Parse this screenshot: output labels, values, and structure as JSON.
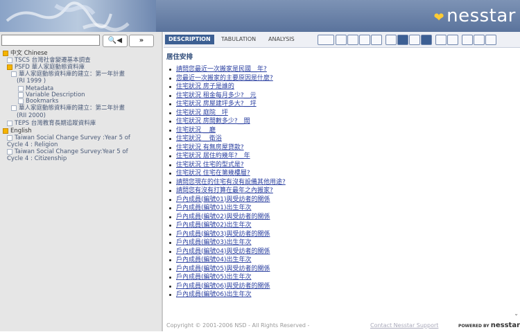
{
  "header": {
    "logo_text": "nesstar",
    "logo_mark": "❤"
  },
  "search": {
    "value": "",
    "find_label": "🔍◀",
    "next_label": "»"
  },
  "tree": [
    {
      "label": "中文 Chinese",
      "state": "open"
    },
    {
      "label": "TSCS 台灣社會變遷基本調查",
      "state": "closed"
    },
    {
      "label": "PSFD 華人家庭動態資料庫",
      "state": "open"
    },
    {
      "label": "華人家庭動態資料庫的建立：第一年計畫",
      "state": "closed"
    },
    {
      "label": "(RI 1999 )",
      "state": "none"
    },
    {
      "label": "Metadata",
      "state": "closed"
    },
    {
      "label": "Variable Description",
      "state": "closed"
    },
    {
      "label": "Bookmarks",
      "state": "closed"
    },
    {
      "label": "華人家庭動態資料庫的建立：第二年計畫",
      "state": "closed"
    },
    {
      "label": "(RII 2000)",
      "state": "none"
    },
    {
      "label": "TEPS 台灣教育長期追蹤資料庫",
      "state": "closed"
    },
    {
      "label": "English",
      "state": "open"
    },
    {
      "label": "Taiwan Social Change Survey :Year 5 of",
      "state": "closed"
    },
    {
      "label": "Cycle 4 : Religion",
      "state": "none"
    },
    {
      "label": "Taiwan Social Change Survey:Year 5 of",
      "state": "closed"
    },
    {
      "label": "Cycle 4 : Citizenship",
      "state": "none"
    }
  ],
  "tabs": [
    {
      "label": "DESCRIPTION",
      "active": true
    },
    {
      "label": "TABULATION",
      "active": false
    },
    {
      "label": "ANALYSIS",
      "active": false
    }
  ],
  "toolbar_icons": [
    "select-box-icon",
    "bar-chart-icon",
    "cross-icon",
    "circle-icon",
    "circle-icon",
    "graph-icon",
    "filter-icon",
    "cube-icon",
    "save-icon",
    "text-icon",
    "doc-icon",
    "print-icon",
    "page-icon",
    "help-icon"
  ],
  "content": {
    "section_title": "居住安排",
    "variables": [
      "請問您最近一次搬家是民國__年?",
      "您最近一次搬家的主要原因是什麼?",
      "住宅狀況 房子是誰的",
      "住宅狀況 租金每月多少?__元",
      "住宅狀況 房屋建坪多大?__坪",
      "住宅狀況 庭院__坪",
      "住宅狀況 房間數多少?__間",
      "住宅狀況 __廳",
      "住宅狀況 __衛浴",
      "住宅狀況 有無房屋貸款?",
      "住宅狀況 居住約幾年?__年",
      "住宅狀況 住宅的型式是?",
      "住宅狀況 住宅在第幾樓層?",
      "請問您現在的住宅有沒有設備其他用途?",
      "請問您有沒有打算在最年之內搬家?",
      "戶內成員(編號01)與受訪者的關係",
      "戶內成員(編號01)出生年次",
      "戶內成員(編號02)與受訪者的關係",
      "戶內成員(編號02)出生年次",
      "戶內成員(編號03)與受訪者的關係",
      "戶內成員(編號03)出生年次",
      "戶內成員(編號04)與受訪者的關係",
      "戶內成員(編號04)出生年次",
      "戶內成員(編號05)與受訪者的關係",
      "戶內成員(編號05)出生年次",
      "戶內成員(編號06)與受訪者的關係",
      "戶內成員(編號06)出生年次"
    ]
  },
  "footer": {
    "copyright": "Copyright © 2001-2006 NSD - All Rights Reserved -",
    "contact": "Contact Nesstar Support",
    "powered_label": "POWERED BY",
    "powered_brand": "nesstar"
  },
  "colors": {
    "header": "#5a739c",
    "tab_active": "#3c5f93",
    "link": "#2a3fa0",
    "sidebar_bg": "#e6e6e6"
  }
}
